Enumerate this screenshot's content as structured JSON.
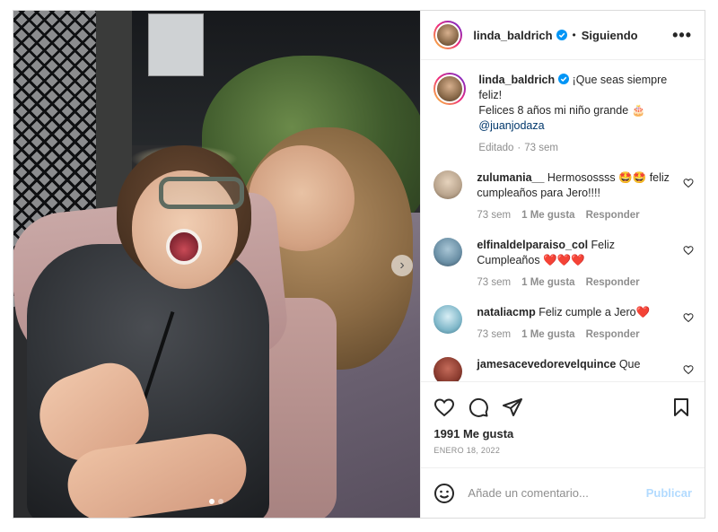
{
  "header": {
    "username": "linda_baldrich",
    "separator": "•",
    "follow_status": "Siguiendo",
    "more_label": "•••"
  },
  "caption": {
    "username": "linda_baldrich",
    "line1": " ¡Que seas siempre feliz!",
    "line2": "Felices 8 años mi niño grande 🎂",
    "mention": "@juanjodaza",
    "edited": "Editado",
    "dot": "·",
    "time": "73 sem"
  },
  "comments": [
    {
      "username": "zulumania__",
      "text": " Hermosossss 🤩🤩 feliz cumpleaños para Jero!!!!",
      "time": "73 sem",
      "likes": "1 Me gusta",
      "reply": "Responder",
      "avatar_color": "#b9a48d"
    },
    {
      "username": "elfinaldelparaiso_col",
      "text": " Feliz Cumpleaños ❤️❤️❤️",
      "time": "73 sem",
      "likes": "1 Me gusta",
      "reply": "Responder",
      "avatar_color": "#6a8fa5"
    },
    {
      "username": "nataliacmp",
      "text": " Feliz cumple a Jero❤️",
      "time": "73 sem",
      "likes": "1 Me gusta",
      "reply": "Responder",
      "avatar_color": "#7fb7c9"
    },
    {
      "username": "jamesacevedorevelquince",
      "text": " Que",
      "time": "",
      "likes": "",
      "reply": "",
      "avatar_color": "#8a3b2f"
    }
  ],
  "actions": {
    "likes_count": "1991 Me gusta",
    "date": "ENERO 18, 2022"
  },
  "add_comment": {
    "placeholder": "Añade un comentario...",
    "publish_label": "Publicar"
  },
  "colors": {
    "verified": "#0095f6",
    "link": "#00376b",
    "muted": "#8e8e8e",
    "publish_disabled": "#b3dbff"
  },
  "icons": [
    "more-icon",
    "verified-icon",
    "next-arrow-icon",
    "heart-icon",
    "comment-icon",
    "share-icon",
    "save-icon",
    "emoji-icon"
  ],
  "carousel": {
    "slides": 2,
    "active_index": 0
  }
}
